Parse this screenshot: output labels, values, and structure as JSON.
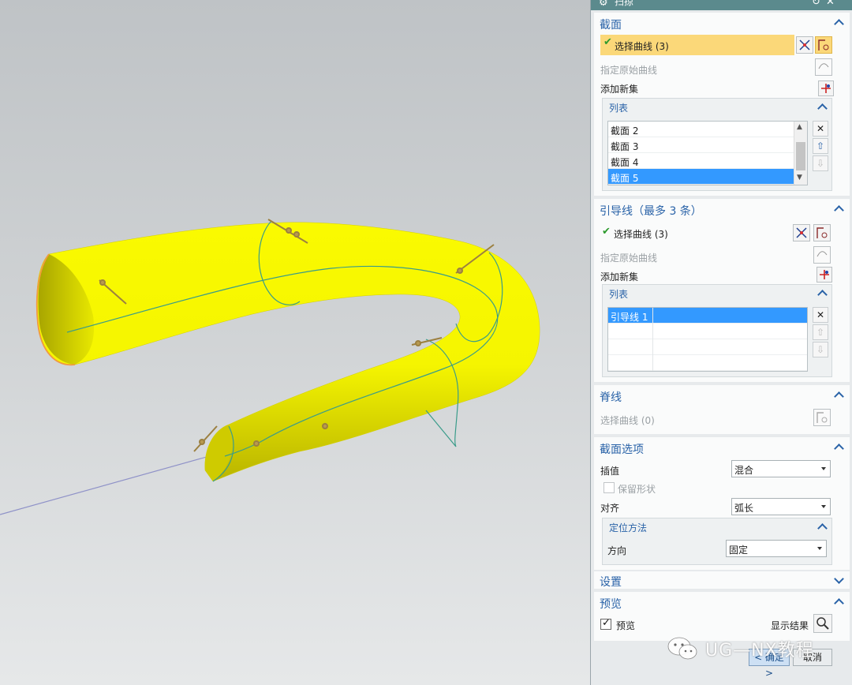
{
  "window": {
    "title": "扫掠"
  },
  "section_section": {
    "title": "截面",
    "select_curve_label": "选择曲线 (3)",
    "specify_origin_label": "指定原始曲线",
    "add_new_set_label": "添加新集",
    "list": {
      "title": "列表",
      "items": [
        "截面 2",
        "截面 3",
        "截面 4",
        "截面 5"
      ],
      "selected_index": 3
    }
  },
  "guides_section": {
    "title": "引导线（最多 3 条）",
    "select_curve_label": "选择曲线 (3)",
    "specify_origin_label": "指定原始曲线",
    "add_new_set_label": "添加新集",
    "list": {
      "title": "列表",
      "items": [
        "引导线 1"
      ],
      "selected_index": 0
    }
  },
  "spine_section": {
    "title": "脊线",
    "select_curve_label": "选择曲线 (0)"
  },
  "section_options": {
    "title": "截面选项",
    "interpolation_label": "插值",
    "interpolation_value": "混合",
    "preserve_shape_label": "保留形状",
    "alignment_label": "对齐",
    "alignment_value": "弧长",
    "orientation": {
      "title": "定位方法",
      "direction_label": "方向",
      "direction_value": "固定"
    }
  },
  "settings_section": {
    "title": "设置"
  },
  "preview_section": {
    "title": "预览",
    "preview_label": "预览",
    "preview_checked": true,
    "show_result_label": "显示结果"
  },
  "buttons": {
    "ok": "< 确定 >",
    "cancel": "取消"
  },
  "watermark": {
    "text": "UG—NX教程"
  },
  "colors": {
    "surface_yellow": "#f5f500",
    "title_bar": "#5b8a8d",
    "selected_row": "#fbd879",
    "list_highlight": "#3399ff",
    "accent_blue": "#2a63a8"
  }
}
